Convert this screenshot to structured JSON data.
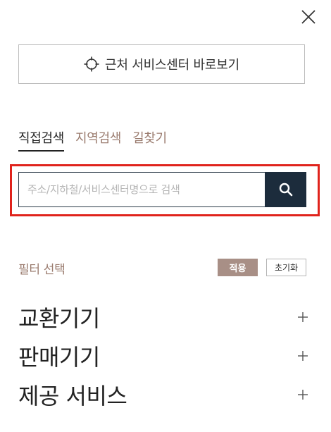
{
  "panel": {
    "nearby_button_label": "근처 서비스센터 바로보기"
  },
  "icons": {
    "close": "close-icon",
    "location_target": "crosshair-icon",
    "search": "search-icon",
    "expand": "plus-icon"
  },
  "tabs": [
    {
      "label": "직접검색",
      "active": true
    },
    {
      "label": "지역검색",
      "active": false
    },
    {
      "label": "길찾기",
      "active": false
    }
  ],
  "search": {
    "placeholder": "주소/지하철/서비스센터명으로 검색",
    "value": ""
  },
  "filter": {
    "title": "필터 선택",
    "apply_label": "적용",
    "reset_label": "초기화",
    "groups": [
      {
        "label": "교환기기"
      },
      {
        "label": "판매기기"
      },
      {
        "label": "제공 서비스"
      }
    ]
  },
  "colors": {
    "accent_brown": "#9a7b6e",
    "apply_button_bg": "#a88f86",
    "search_button_bg": "#1c2c3c",
    "highlight_red": "#e0231c"
  }
}
